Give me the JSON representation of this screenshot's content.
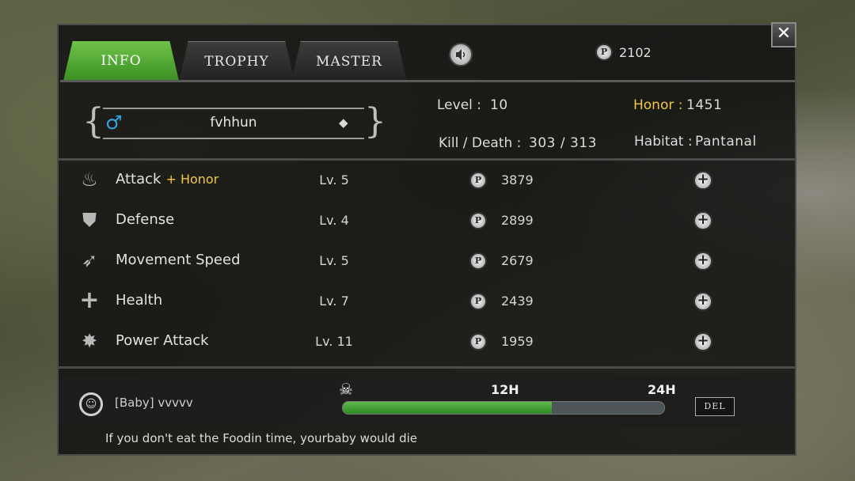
{
  "tabs": [
    {
      "label": "INFO",
      "active": true
    },
    {
      "label": "TROPHY",
      "active": false
    },
    {
      "label": "MASTER",
      "active": false
    }
  ],
  "header": {
    "points_total": "2102",
    "close_label": "✕",
    "points_icon_label": "P"
  },
  "profile": {
    "name": "fvhhun",
    "gender_icon": "♂",
    "level_label": "Level :",
    "level_value": "10",
    "honor_label": "Honor :",
    "honor_value": "1451",
    "kill_death_label": "Kill / Death :",
    "kill_death_value": "303 / 313",
    "habitat_label": "Habitat :",
    "habitat_value": "Pantanal"
  },
  "skills": [
    {
      "name": "Attack",
      "bonus": "+ Honor",
      "level": "Lv. 5",
      "cost": "3879",
      "icon": "flame-icon"
    },
    {
      "name": "Defense",
      "bonus": "",
      "level": "Lv. 4",
      "cost": "2899",
      "icon": "shield-icon"
    },
    {
      "name": "Movement Speed",
      "bonus": "",
      "level": "Lv. 5",
      "cost": "2679",
      "icon": "wing-icon"
    },
    {
      "name": "Health",
      "bonus": "",
      "level": "Lv. 7",
      "cost": "2439",
      "icon": "cross-icon"
    },
    {
      "name": "Power Attack",
      "bonus": "",
      "level": "Lv. 11",
      "cost": "1959",
      "icon": "burst-icon"
    }
  ],
  "baby": {
    "tag": "[Baby]  vvvvv",
    "time_mid": "12H",
    "time_end": "24H",
    "food_progress": 0.65,
    "del_label": "DEL",
    "warning": "If you don't eat the Foodin time, yourbaby would die"
  },
  "colors": {
    "active_tab": "#4aa42f",
    "honor": "#f2c744",
    "gender": "#35a3e0",
    "progress": "#4caf3f"
  }
}
